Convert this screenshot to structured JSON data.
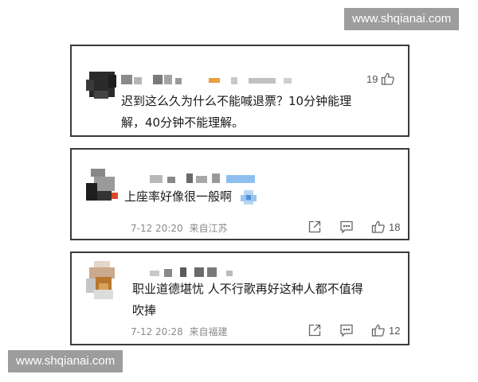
{
  "watermark": {
    "text": "www.shqianai.com"
  },
  "comments": [
    {
      "like_count": "19",
      "text_line1": "迟到这么久为什么不能喊退票？10分钟能理",
      "text_line2": "解，40分钟不能理解。"
    },
    {
      "text_line1": "上座率好像很一般啊",
      "timestamp": "7-12 20:20",
      "location": "来自江苏",
      "like_count": "18"
    },
    {
      "text_line1": "职业道德堪忧 人不行歌再好这种人都不值得",
      "text_line2": "吹捧",
      "timestamp": "7-12 20:28",
      "location": "来自福建",
      "like_count": "12"
    }
  ]
}
